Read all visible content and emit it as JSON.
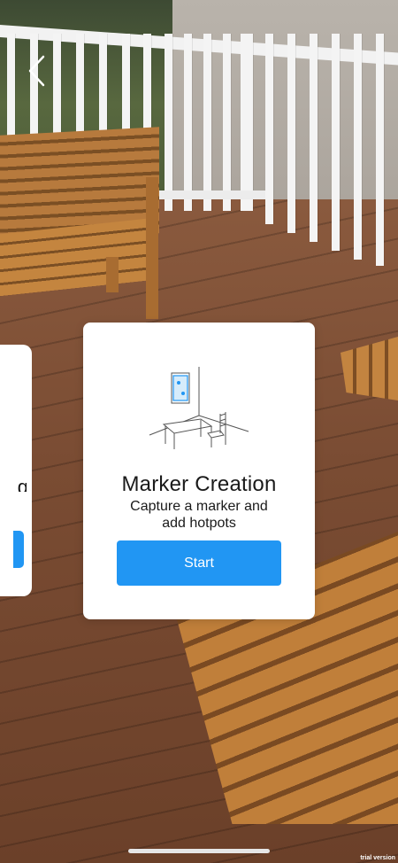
{
  "navigation": {
    "back_icon": "chevron-left-icon"
  },
  "side_card": {
    "title_fragment": "g"
  },
  "card": {
    "illustration_icon": "room-with-marker-icon",
    "title": "Marker Creation",
    "subtitle": "Capture a marker and\nadd hotpots",
    "start_label": "Start"
  },
  "colors": {
    "accent": "#2196f3",
    "card_background": "#ffffff",
    "text": "#1a1a1a"
  },
  "watermark": {
    "text": "trial version"
  }
}
